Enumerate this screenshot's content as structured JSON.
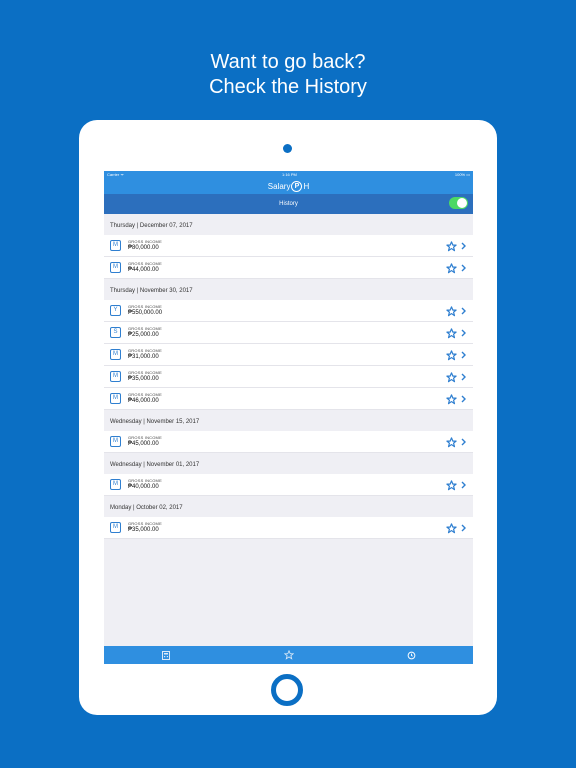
{
  "headline": {
    "line1": "Want to go back?",
    "line2": "Check the History"
  },
  "status": {
    "carrier": "Carrier ᯤ",
    "time": "1:16 PM",
    "battery": "100% ▭"
  },
  "app": {
    "title_prefix": "Salary",
    "logo_letter": "P",
    "title_suffix": "H"
  },
  "nav": {
    "title": "History",
    "toggle_on": true
  },
  "row_label": "GROSS INCOME",
  "sections": [
    {
      "date": "Thursday | December 07, 2017",
      "rows": [
        {
          "badge": "M",
          "amount": "₱80,000.00"
        },
        {
          "badge": "M",
          "amount": "₱44,000.00"
        }
      ]
    },
    {
      "date": "Thursday | November 30, 2017",
      "rows": [
        {
          "badge": "Y",
          "amount": "₱550,000.00"
        },
        {
          "badge": "S",
          "amount": "₱25,000.00"
        },
        {
          "badge": "M",
          "amount": "₱31,000.00"
        },
        {
          "badge": "M",
          "amount": "₱35,000.00"
        },
        {
          "badge": "M",
          "amount": "₱46,000.00"
        }
      ]
    },
    {
      "date": "Wednesday | November 15, 2017",
      "rows": [
        {
          "badge": "M",
          "amount": "₱45,000.00"
        }
      ]
    },
    {
      "date": "Wednesday | November 01, 2017",
      "rows": [
        {
          "badge": "M",
          "amount": "₱40,000.00"
        }
      ]
    },
    {
      "date": "Monday | October 02, 2017",
      "rows": [
        {
          "badge": "M",
          "amount": "₱35,000.00"
        }
      ]
    }
  ],
  "tabs": [
    {
      "icon": "calculator-icon"
    },
    {
      "icon": "star-icon"
    },
    {
      "icon": "history-icon"
    }
  ],
  "colors": {
    "background": "#0b6fc4",
    "appbar": "#2f8fe0",
    "navbar": "#2c6fbd",
    "toggle": "#4cd964",
    "accent": "#2f7fd0"
  }
}
